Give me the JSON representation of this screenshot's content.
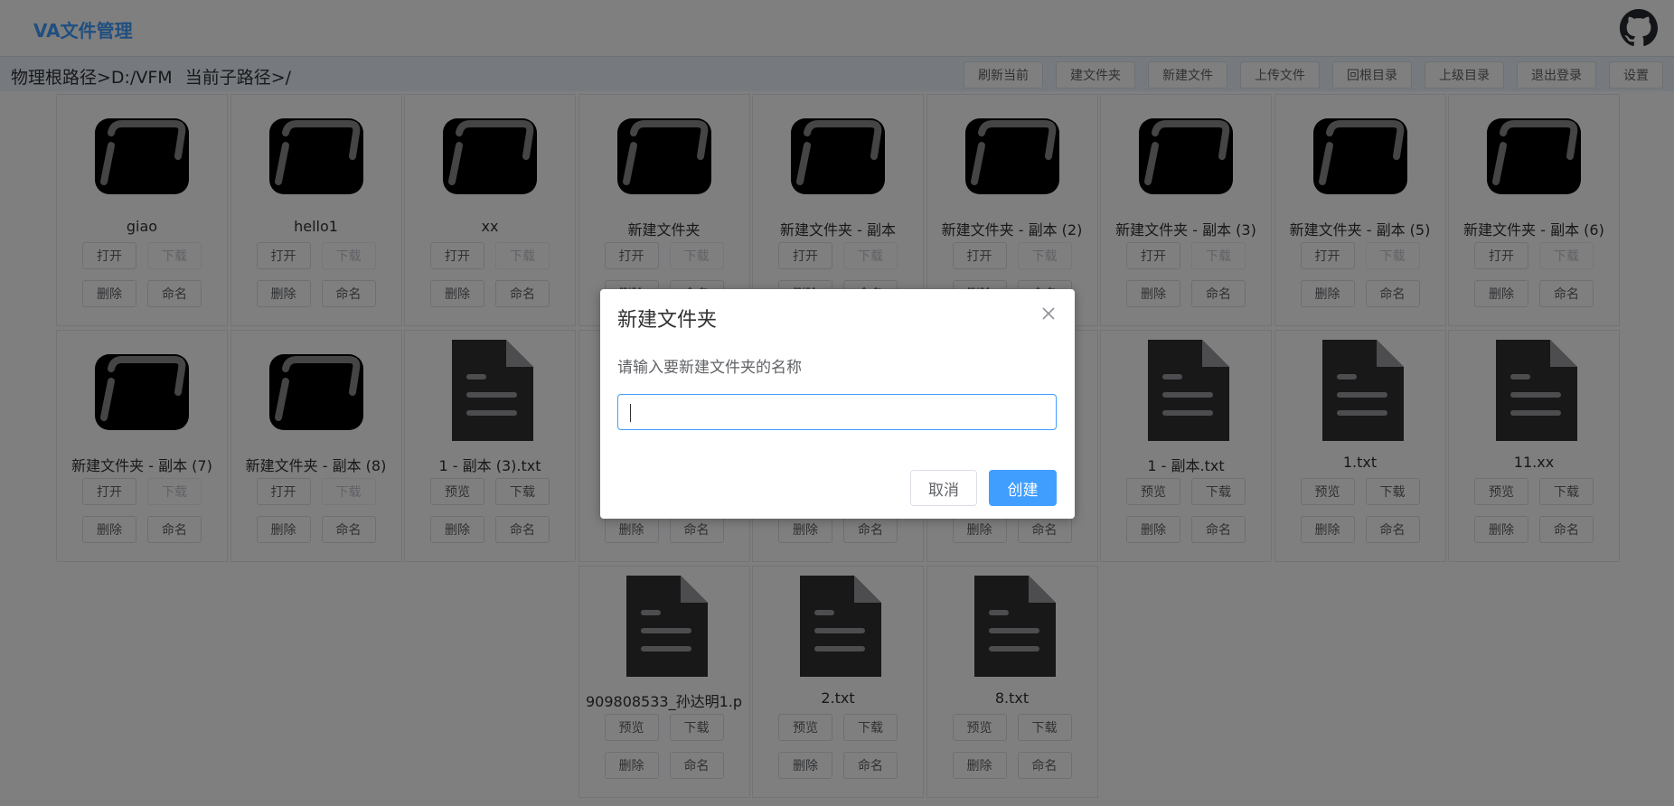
{
  "app": {
    "title": "VA文件管理"
  },
  "path": {
    "root": "物理根路径>D:/VFM",
    "sub": "当前子路径>/"
  },
  "toolbar": [
    "刷新当前",
    "建文件夹",
    "新建文件",
    "上传文件",
    "回根目录",
    "上级目录",
    "退出登录",
    "设置"
  ],
  "labels": {
    "open": "打开",
    "download": "下载",
    "delete": "删除",
    "rename": "命名",
    "preview": "预览"
  },
  "items": [
    {
      "name": "giao",
      "type": "folder"
    },
    {
      "name": "hello1",
      "type": "folder"
    },
    {
      "name": "xx",
      "type": "folder"
    },
    {
      "name": "新建文件夹",
      "type": "folder"
    },
    {
      "name": "新建文件夹 - 副本",
      "type": "folder"
    },
    {
      "name": "新建文件夹 - 副本 (2)",
      "type": "folder"
    },
    {
      "name": "新建文件夹 - 副本 (3)",
      "type": "folder"
    },
    {
      "name": "新建文件夹 - 副本 (5)",
      "type": "folder"
    },
    {
      "name": "新建文件夹 - 副本 (6)",
      "type": "folder"
    },
    {
      "name": "新建文件夹 - 副本 (7)",
      "type": "folder"
    },
    {
      "name": "新建文件夹 - 副本 (8)",
      "type": "folder"
    },
    {
      "name": "1 - 副本 (3).txt",
      "type": "file"
    },
    {
      "name": "",
      "type": "file"
    },
    {
      "name": "",
      "type": "file"
    },
    {
      "name": "",
      "type": "file"
    },
    {
      "name": "1 - 副本.txt",
      "type": "file"
    },
    {
      "name": "1.txt",
      "type": "file"
    },
    {
      "name": "11.xx",
      "type": "file"
    },
    {
      "name": "909808533_孙达明1.p",
      "type": "file"
    },
    {
      "name": "2.txt",
      "type": "file"
    },
    {
      "name": "8.txt",
      "type": "file"
    }
  ],
  "dialog": {
    "title": "新建文件夹",
    "message": "请输入要新建文件夹的名称",
    "input_value": "",
    "cancel": "取消",
    "confirm": "创建"
  },
  "colors": {
    "accent": "#409eff",
    "folder_icon": "#000000",
    "file_icon": "#303133"
  }
}
